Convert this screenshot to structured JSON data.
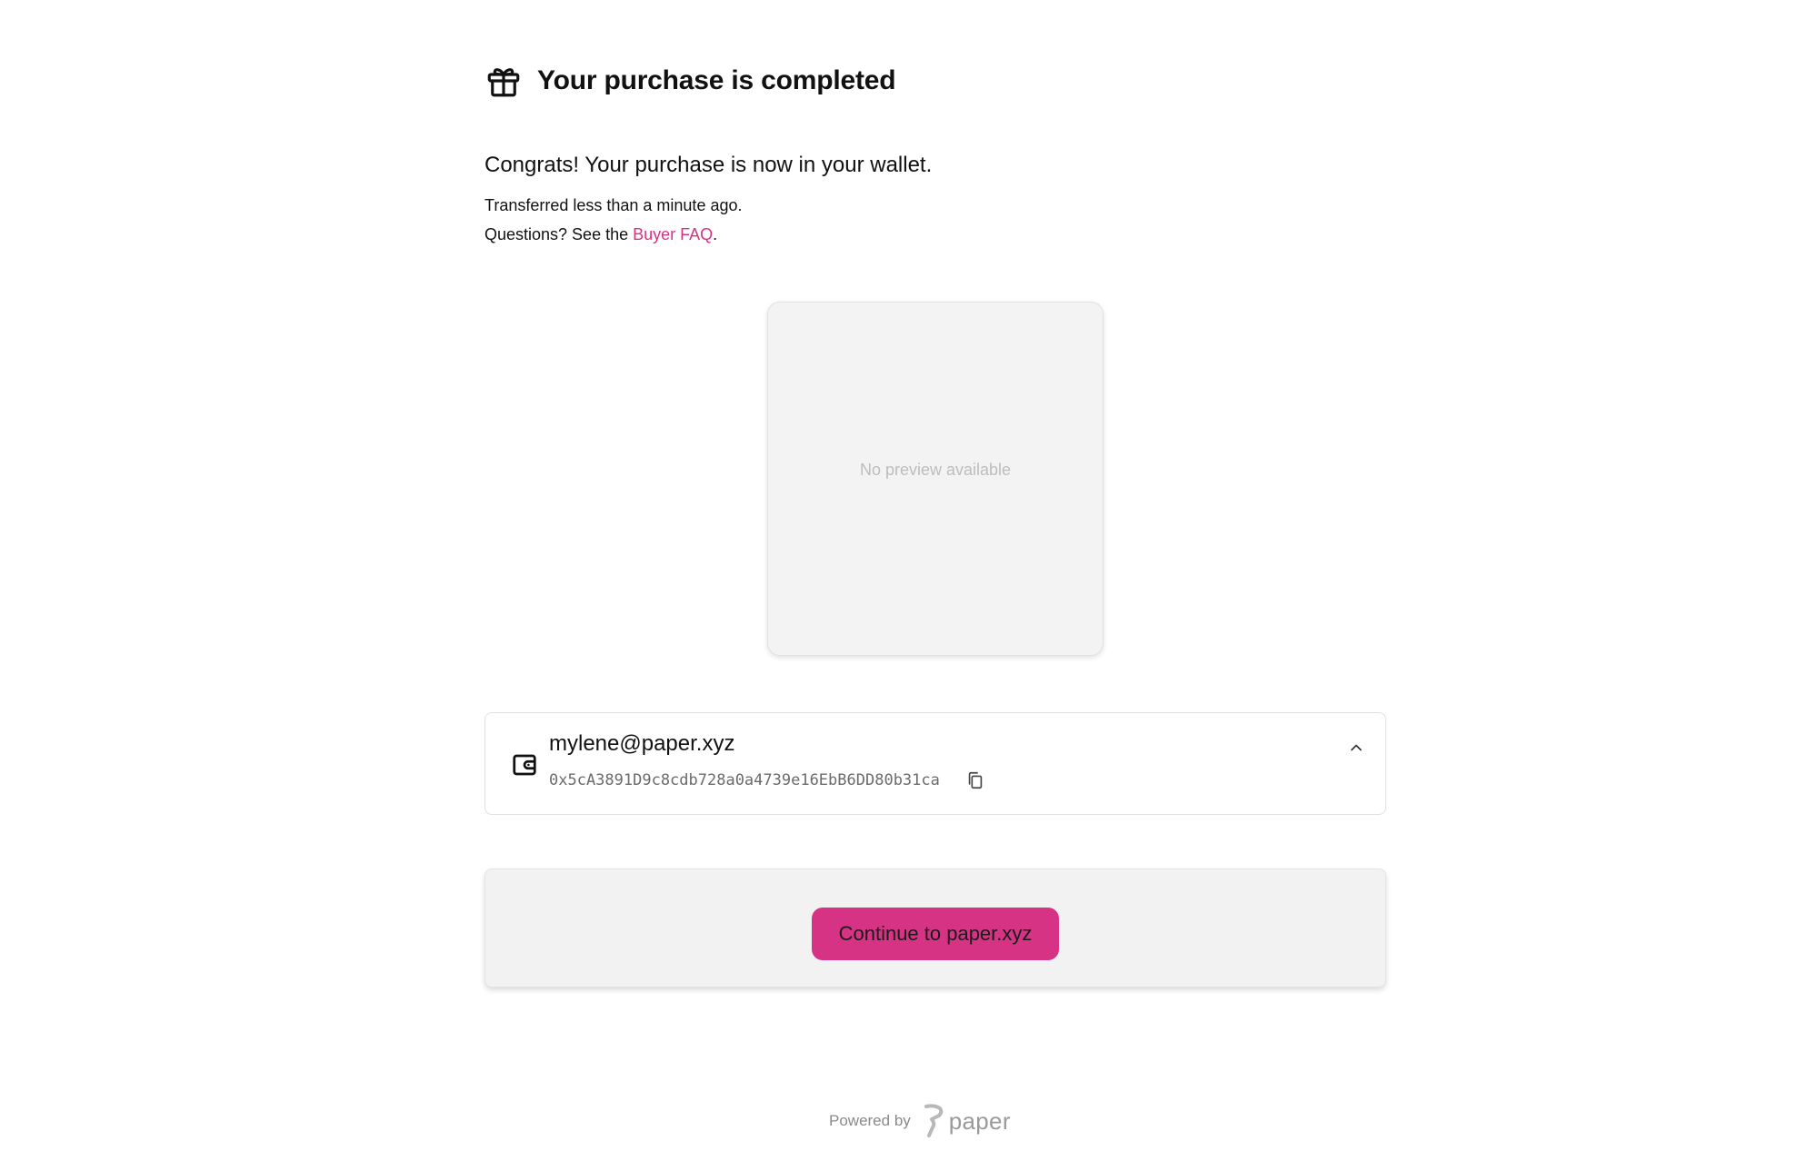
{
  "header": {
    "title": "Your purchase is completed",
    "icon": "gift-icon"
  },
  "message": {
    "congrats": "Congrats! Your purchase is now in your wallet.",
    "transferred": "Transferred less than a minute ago.",
    "questions_prefix": "Questions? See the ",
    "faq_link": "Buyer FAQ",
    "questions_suffix": "."
  },
  "preview": {
    "text": "No preview available"
  },
  "wallet": {
    "icon": "wallet-icon",
    "email": "mylene@paper.xyz",
    "address": "0x5cA3891D9c8cdb728a0a4739e16EbB6DD80b31ca",
    "copy_icon": "copy-icon",
    "toggle_icon": "chevron-up-icon"
  },
  "action": {
    "continue_label": "Continue to paper.xyz"
  },
  "footer": {
    "powered_by": "Powered by",
    "brand": "paper"
  },
  "colors": {
    "accent": "#d63384",
    "panel": "#f2f2f2",
    "muted": "#6b6b6b"
  }
}
